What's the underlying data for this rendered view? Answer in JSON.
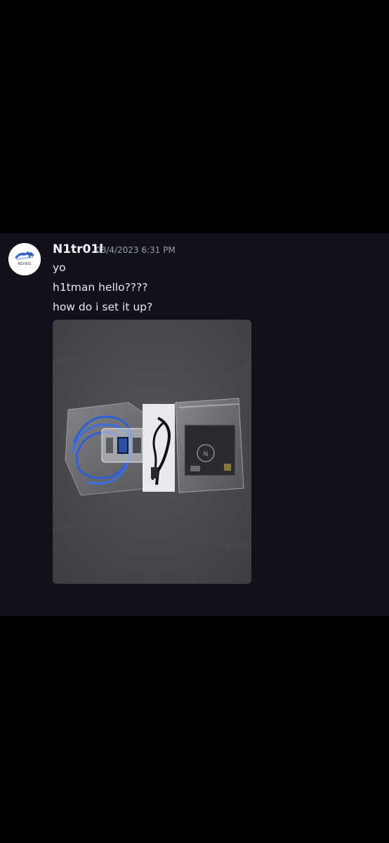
{
  "message": {
    "author": "N1tr01l",
    "timestamp": "08/4/2023 6:31 PM",
    "avatar_text": "N1tr01l",
    "lines": [
      "yo",
      "h1tman hello????",
      "how do i set it up?"
    ]
  },
  "attachment": {
    "type": "image",
    "icon": "photo-attachment"
  },
  "colors": {
    "background": "#000000",
    "chat_background": "#11111c",
    "username": "#f2f3f5",
    "timestamp": "#9a9ca6",
    "message_text": "#e6e7ea"
  }
}
